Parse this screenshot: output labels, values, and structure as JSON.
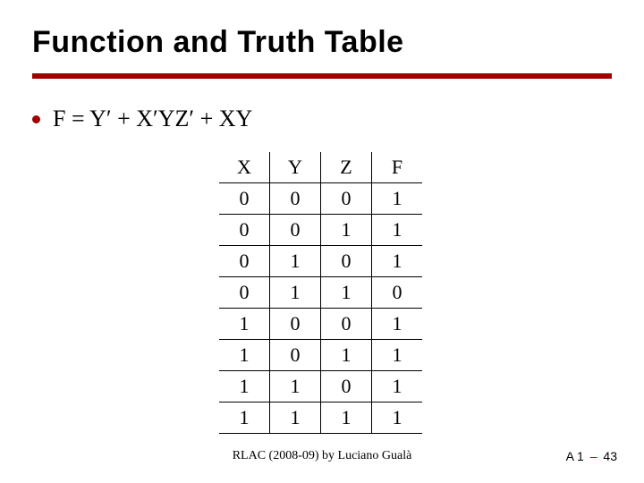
{
  "title": "Function and Truth Table",
  "bullet": "F = Y′ + X′YZ′ + XY",
  "chart_data": {
    "type": "table",
    "columns": [
      "X",
      "Y",
      "Z",
      "F"
    ],
    "rows": [
      [
        "0",
        "0",
        "0",
        "1"
      ],
      [
        "0",
        "0",
        "1",
        "1"
      ],
      [
        "0",
        "1",
        "0",
        "1"
      ],
      [
        "0",
        "1",
        "1",
        "0"
      ],
      [
        "1",
        "0",
        "0",
        "1"
      ],
      [
        "1",
        "0",
        "1",
        "1"
      ],
      [
        "1",
        "1",
        "0",
        "1"
      ],
      [
        "1",
        "1",
        "1",
        "1"
      ]
    ]
  },
  "footer": {
    "center": "RLAC (2008-09) by Luciano Gualà",
    "right_prefix": "A 1",
    "right_dash": "–",
    "right_page": "43"
  }
}
